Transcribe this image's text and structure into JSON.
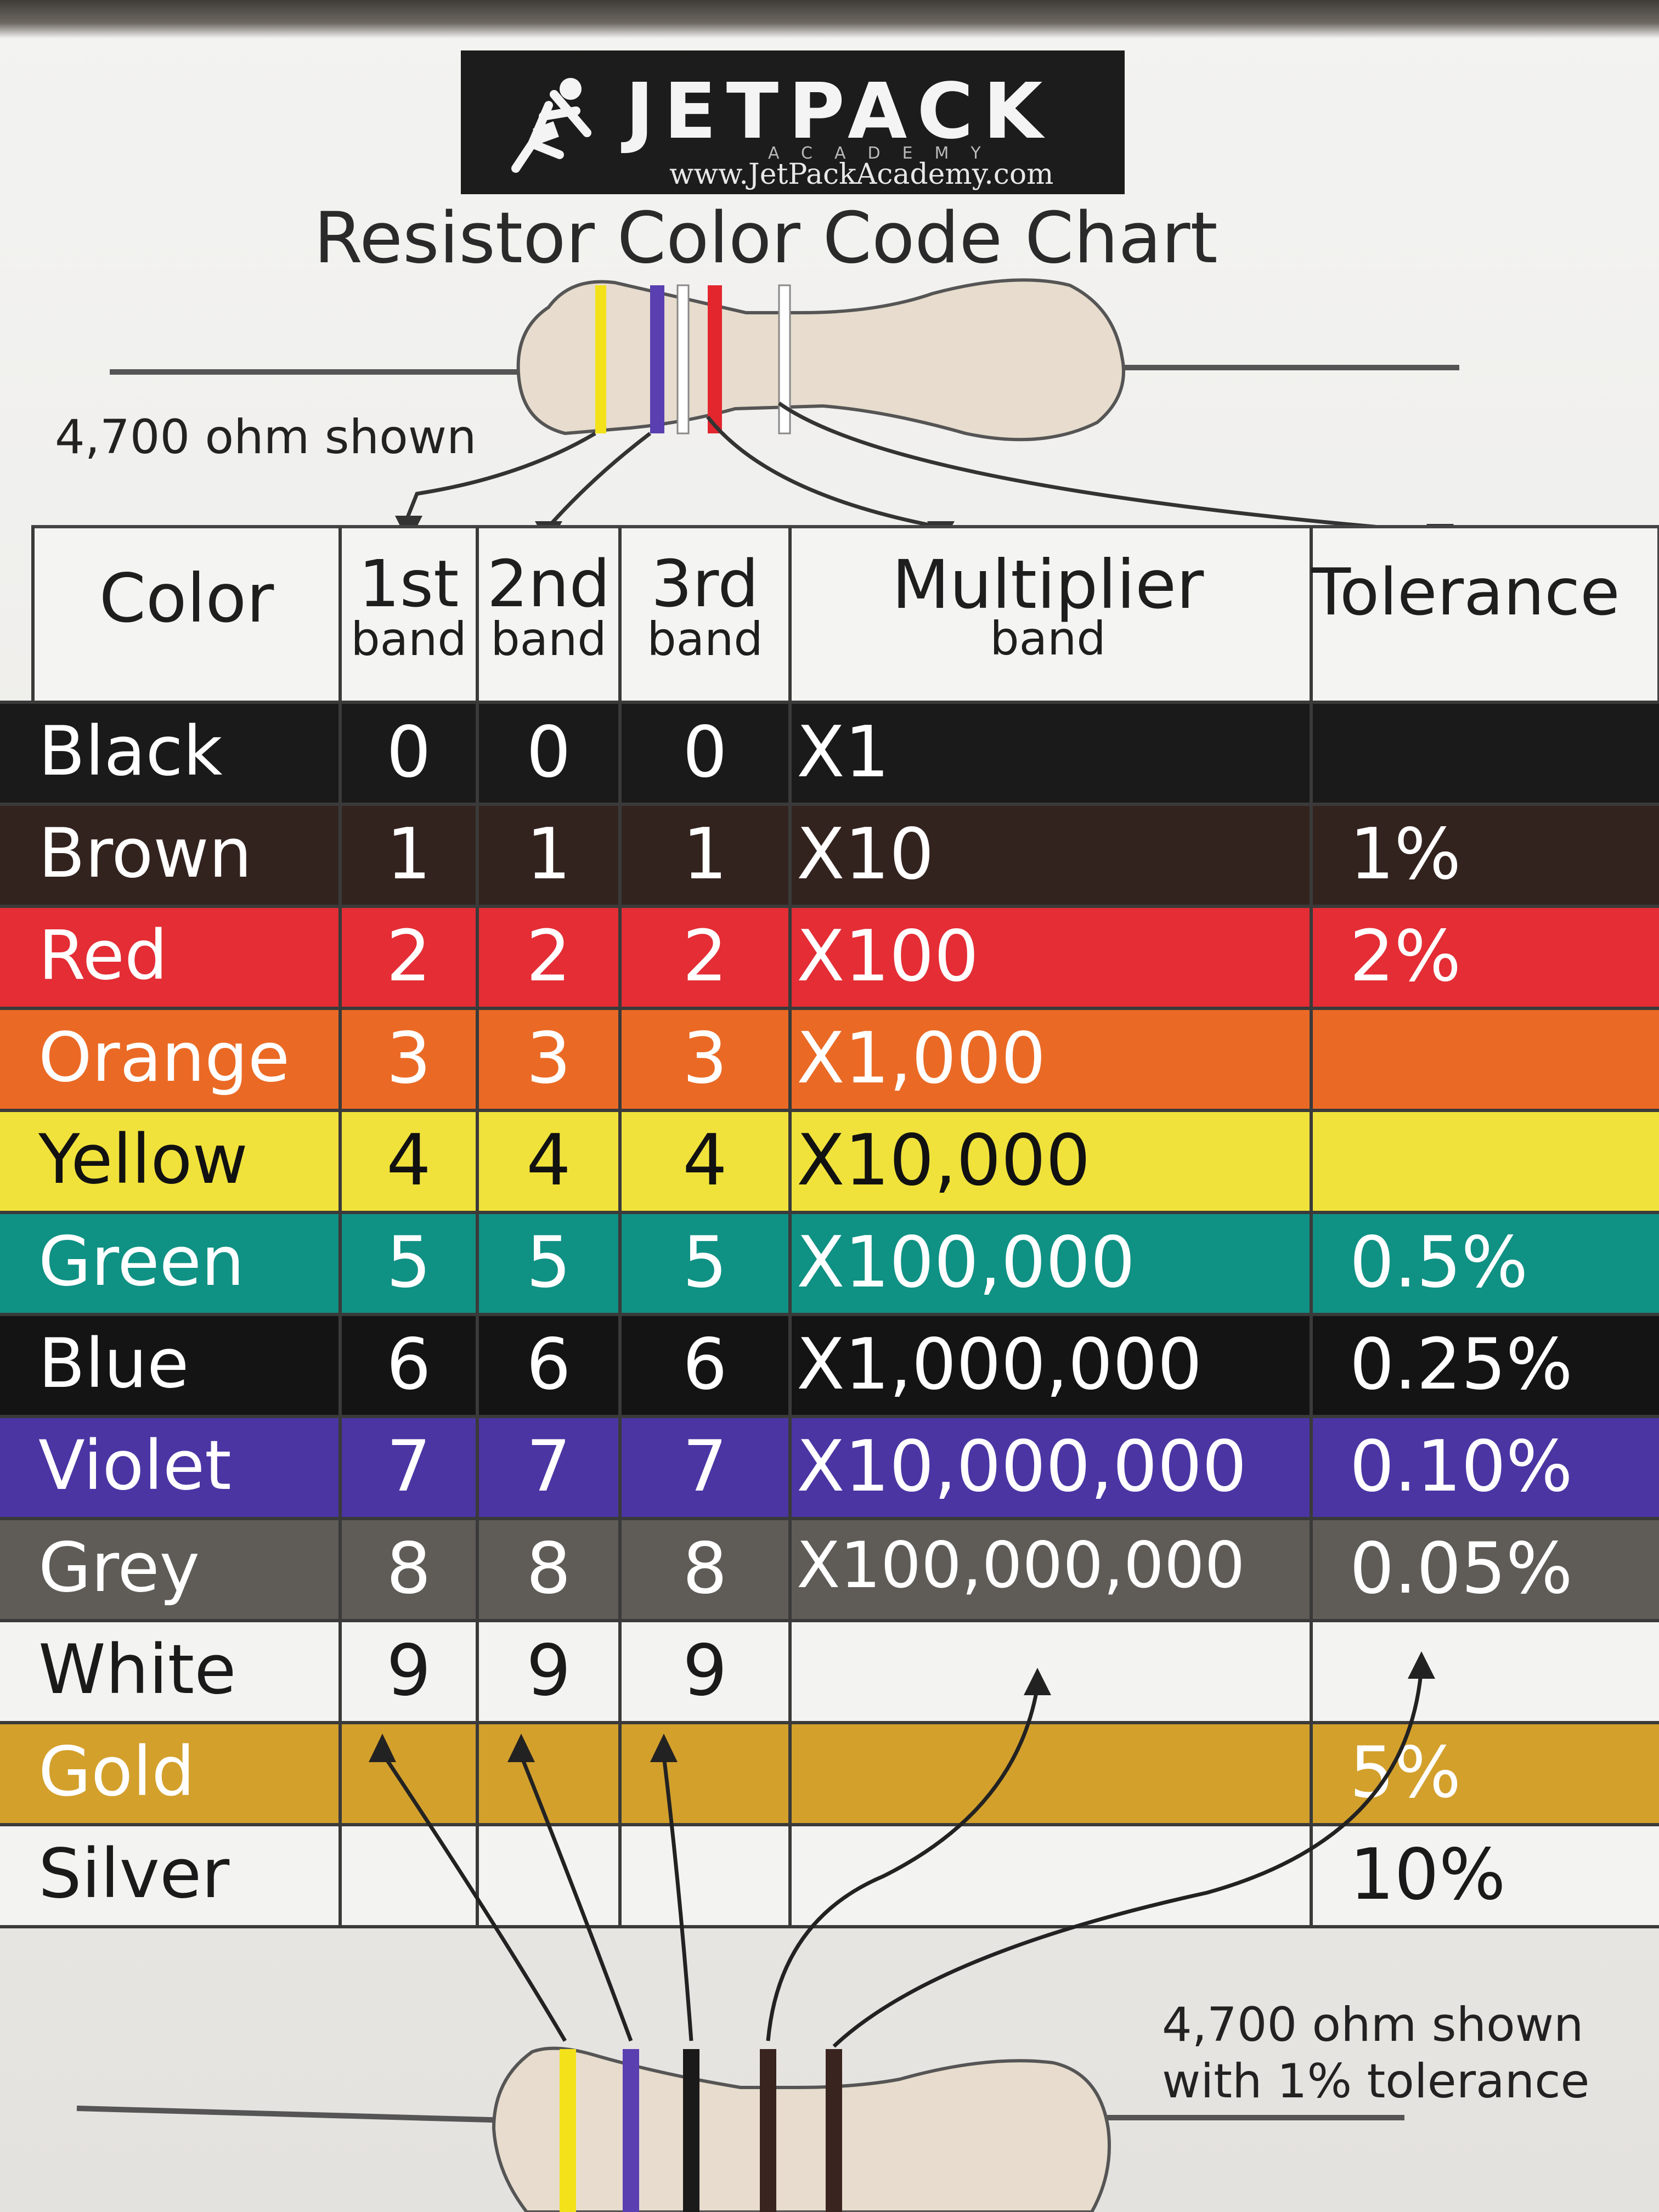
{
  "logo": {
    "brand": "JETPACK",
    "sub": "ACADEMY",
    "url": "www.JetPackAcademy.com",
    "icon": "jetpack-runner-icon"
  },
  "title": "Resistor Color Code Chart",
  "note_top": "4,700 ohm shown",
  "note_bottom": [
    "4,700 ohm shown",
    "with 1% tolerance"
  ],
  "headers": {
    "color": "Color",
    "band1": [
      "1st",
      "band"
    ],
    "band2": [
      "2nd",
      "band"
    ],
    "band3": [
      "3rd",
      "band"
    ],
    "multiplier": [
      "Multiplier",
      "band"
    ],
    "tolerance": "Tolerance"
  },
  "rows": [
    {
      "color": "Black",
      "b1": "0",
      "b2": "0",
      "b3": "0",
      "mult": "X1",
      "tol": "",
      "bg": "#1a1a1a",
      "fg": "#ffffff"
    },
    {
      "color": "Brown",
      "b1": "1",
      "b2": "1",
      "b3": "1",
      "mult": "X10",
      "tol": "1%",
      "bg": "#33231f",
      "fg": "#ffffff"
    },
    {
      "color": "Red",
      "b1": "2",
      "b2": "2",
      "b3": "2",
      "mult": "X100",
      "tol": "2%",
      "bg": "#e42d35",
      "fg": "#ffffff"
    },
    {
      "color": "Orange",
      "b1": "3",
      "b2": "3",
      "b3": "3",
      "mult": "X1,000",
      "tol": "",
      "bg": "#ea6a25",
      "fg": "#ffffff"
    },
    {
      "color": "Yellow",
      "b1": "4",
      "b2": "4",
      "b3": "4",
      "mult": "X10,000",
      "tol": "",
      "bg": "#f0e23b",
      "fg": "#111111"
    },
    {
      "color": "Green",
      "b1": "5",
      "b2": "5",
      "b3": "5",
      "mult": "X100,000",
      "tol": "0.5%",
      "bg": "#0f9184",
      "fg": "#ffffff"
    },
    {
      "color": "Blue",
      "b1": "6",
      "b2": "6",
      "b3": "6",
      "mult": "X1,000,000",
      "tol": "0.25%",
      "bg": "#141414",
      "fg": "#ffffff"
    },
    {
      "color": "Violet",
      "b1": "7",
      "b2": "7",
      "b3": "7",
      "mult": "X10,000,000",
      "tol": "0.10%",
      "bg": "#4b35a3",
      "fg": "#ffffff"
    },
    {
      "color": "Grey",
      "b1": "8",
      "b2": "8",
      "b3": "8",
      "mult": "X100,000,000",
      "tol": "0.05%",
      "bg": "#5f5c58",
      "fg": "#ffffff"
    },
    {
      "color": "White",
      "b1": "9",
      "b2": "9",
      "b3": "9",
      "mult": "",
      "tol": "",
      "bg": "#f3f3f1",
      "fg": "#1a1a1a"
    },
    {
      "color": "Gold",
      "b1": "",
      "b2": "",
      "b3": "",
      "mult": "",
      "tol": "5%",
      "bg": "#d3a02c",
      "fg": "#ffffff"
    },
    {
      "color": "Silver",
      "b1": "",
      "b2": "",
      "b3": "",
      "mult": "",
      "tol": "10%",
      "bg": "#f3f3f1",
      "fg": "#1a1a1a"
    }
  ],
  "resistor": {
    "body_color": "#e7dccd",
    "top_bands": [
      "#f3e21a",
      "#5a3fb0",
      "#ffffff",
      "#e3262e",
      "#ffffff"
    ],
    "bottom_bands": [
      "#f3e21a",
      "#5a3fb0",
      "#1a1a1a",
      "#3a2420",
      "#3a2420"
    ]
  }
}
